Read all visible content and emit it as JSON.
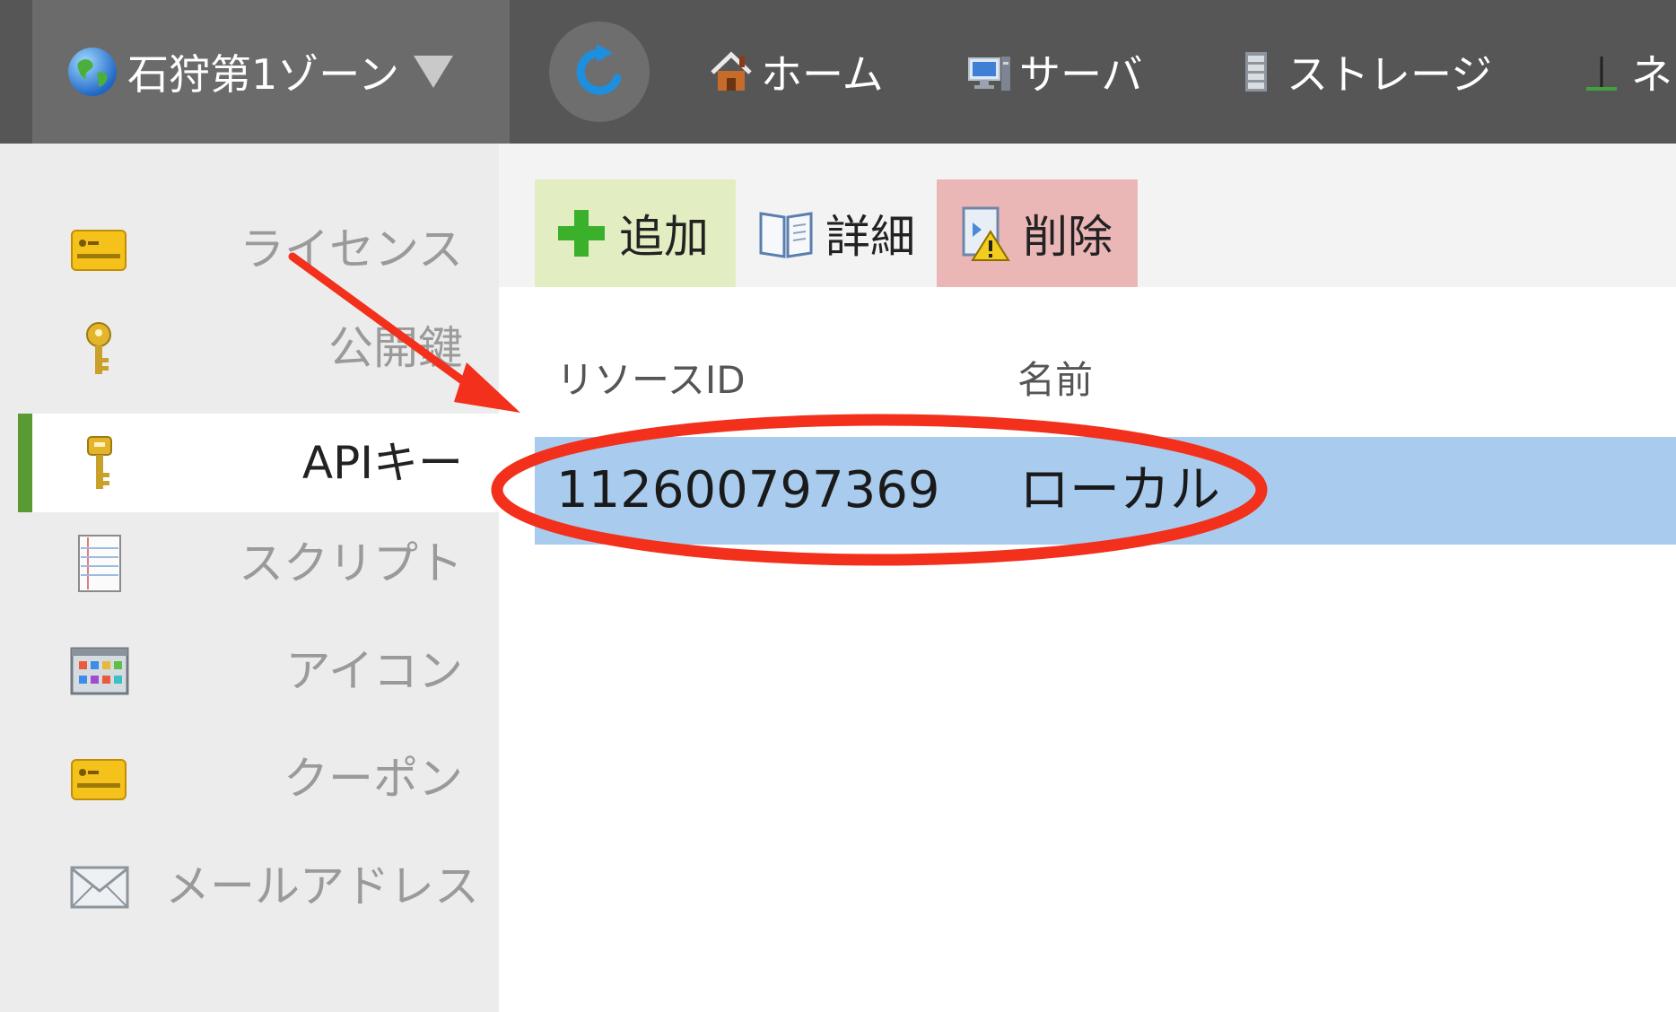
{
  "header": {
    "zone_label": "石狩第1ゾーン",
    "nav": [
      {
        "label": "ホーム"
      },
      {
        "label": "サーバ"
      },
      {
        "label": "ストレージ"
      },
      {
        "label": "ネ"
      }
    ]
  },
  "sidebar": {
    "items": [
      {
        "label": "ライセンス",
        "active": false
      },
      {
        "label": "公開鍵",
        "active": false
      },
      {
        "label": "APIキー",
        "active": true
      },
      {
        "label": "スクリプト",
        "active": false
      },
      {
        "label": "アイコン",
        "active": false
      },
      {
        "label": "クーポン",
        "active": false
      },
      {
        "label": "メールアドレス",
        "active": false
      }
    ]
  },
  "toolbar": {
    "add_label": "追加",
    "detail_label": "詳細",
    "delete_label": "削除"
  },
  "table": {
    "columns": [
      "リソースID",
      "名前"
    ],
    "rows": [
      {
        "resource_id": "112600797369",
        "name": "ローカル",
        "selected": true
      }
    ]
  },
  "colors": {
    "topbar": "#565656",
    "sidebar_bg": "#ececec",
    "active_indicator": "#5a9a33",
    "selected_row": "#a9cbee",
    "add_button_bg": "#e2edc2",
    "delete_button_bg": "#eab6b6",
    "annotation": "#f2301b"
  }
}
